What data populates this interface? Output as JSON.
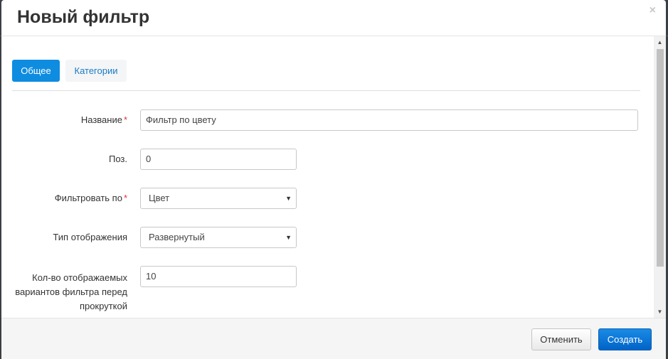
{
  "modal": {
    "title": "Новый фильтр",
    "close_glyph": "×"
  },
  "tabs": [
    {
      "label": "Общее",
      "active": true
    },
    {
      "label": "Категории",
      "active": false
    }
  ],
  "form": {
    "name": {
      "label": "Название",
      "required": true,
      "value": "Фильтр по цвету"
    },
    "position": {
      "label": "Поз.",
      "required": false,
      "value": "0"
    },
    "filter_by": {
      "label": "Фильтровать по",
      "required": true,
      "value": "Цвет"
    },
    "display_type": {
      "label": "Тип отображения",
      "required": false,
      "value": "Развернутый"
    },
    "visible_count": {
      "label_lines": [
        "Кол-во отображаемых",
        "вариантов фильтра перед",
        "прокруткой"
      ],
      "required": false,
      "value": "10"
    }
  },
  "footer": {
    "cancel_label": "Отменить",
    "create_label": "Создать"
  },
  "icons": {
    "dropdown": "chevron-down-icon",
    "scroll_up": "scroll-up-icon",
    "scroll_down": "scroll-down-icon"
  },
  "colors": {
    "primary": "#0e8ce0",
    "required_asterisk": "#d9363e"
  },
  "required_mark": "*"
}
